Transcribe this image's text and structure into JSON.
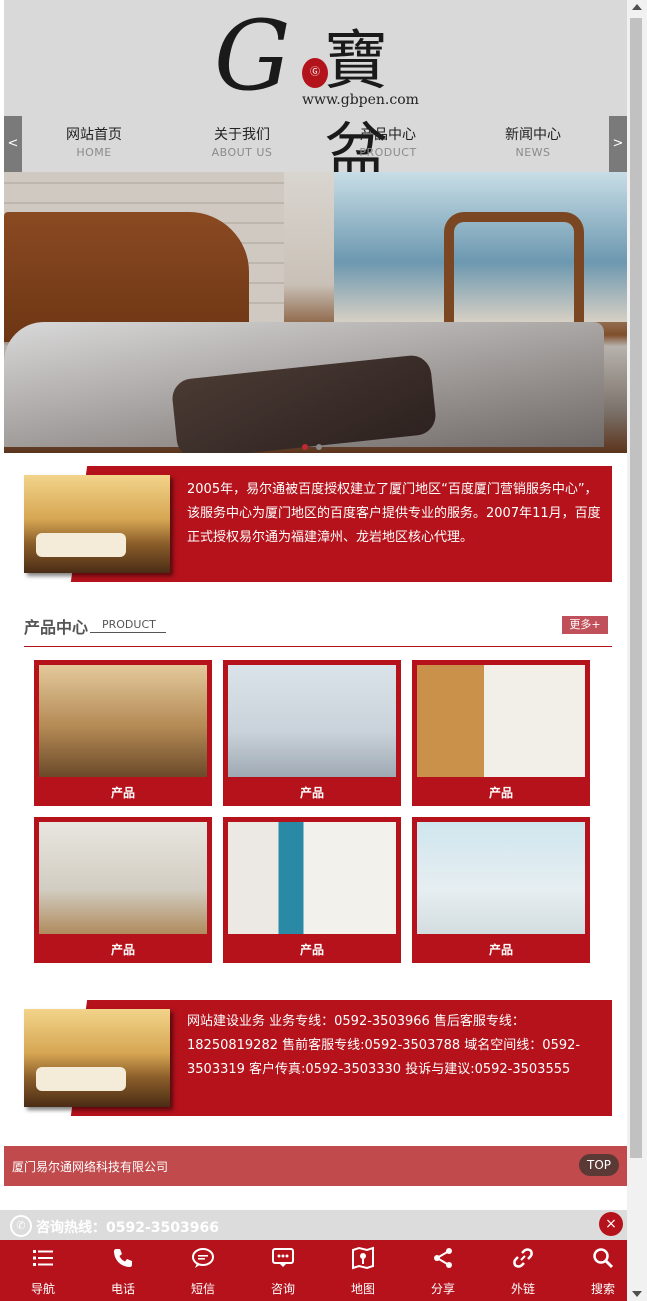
{
  "header": {
    "logo_url_text": "www.gbpen.com",
    "logo_cn": "寶盆",
    "nav": [
      {
        "cn": "网站首页",
        "en": "HOME"
      },
      {
        "cn": "关于我们",
        "en": "ABOUT US"
      },
      {
        "cn": "产品中心",
        "en": "PRODUCT"
      },
      {
        "cn": "新闻中心",
        "en": "NEWS"
      }
    ],
    "prev_arrow": "<",
    "next_arrow": ">"
  },
  "intro": {
    "text": "2005年，易尔通被百度授权建立了厦门地区“百度厦门营销服务中心”，该服务中心为厦门地区的百度客户提供专业的服务。2007年11月，百度正式授权易尔通为福建漳州、龙岩地区核心代理。"
  },
  "products": {
    "title_cn": "产品中心",
    "title_en": "PRODUCT",
    "more": "更多+",
    "items": [
      {
        "label": "产品"
      },
      {
        "label": "产品"
      },
      {
        "label": "产品"
      },
      {
        "label": "产品"
      },
      {
        "label": "产品"
      },
      {
        "label": "产品"
      }
    ]
  },
  "contact": {
    "text": "网站建设业务 业务专线：0592-3503966 售后客服专线：18250819282 售前客服专线:0592-3503788 域名空间线：0592-3503319 客户传真:0592-3503330 投诉与建议:0592-3503555"
  },
  "footer": {
    "company": "厦门易尔通网络科技有限公司",
    "top": "TOP"
  },
  "hotline": {
    "label": "咨询热线：0592-3503966",
    "close": "×"
  },
  "bottom_nav": [
    {
      "label": "导航",
      "icon": "menu-icon"
    },
    {
      "label": "电话",
      "icon": "phone-icon"
    },
    {
      "label": "短信",
      "icon": "sms-icon"
    },
    {
      "label": "咨询",
      "icon": "chat-icon"
    },
    {
      "label": "地图",
      "icon": "map-icon"
    },
    {
      "label": "分享",
      "icon": "share-icon"
    },
    {
      "label": "外链",
      "icon": "link-icon"
    },
    {
      "label": "搜索",
      "icon": "search-icon"
    }
  ],
  "colors": {
    "brand_red": "#b5121b",
    "footer_red": "#c14a4c",
    "header_gray": "#d9d9d9"
  }
}
